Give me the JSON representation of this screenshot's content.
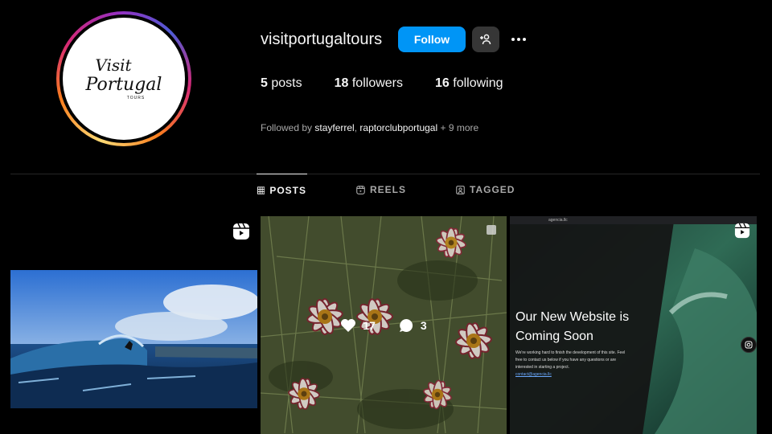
{
  "profile": {
    "username": "visitportugaltours",
    "avatar_logo": {
      "line1": "Visit",
      "line2": "Portugal",
      "line3": "TOURS"
    },
    "follow_label": "Follow",
    "stats": {
      "posts_count": "5",
      "posts_label": "posts",
      "followers_count": "18",
      "followers_label": "followers",
      "following_count": "16",
      "following_label": "following"
    },
    "followed_by": {
      "prefix": "Followed by",
      "user1": "stayferrel",
      "separator": ",",
      "user2": "raptorclubportugal",
      "more": "+ 9 more"
    }
  },
  "tabs": [
    {
      "label": "POSTS",
      "icon": "grid-icon",
      "active": true
    },
    {
      "label": "REELS",
      "icon": "reels-icon",
      "active": false
    },
    {
      "label": "TAGGED",
      "icon": "tagged-icon",
      "active": false
    }
  ],
  "posts": [
    {
      "type": "reel",
      "icon": "reel-icon",
      "subject": "surfer-on-wave"
    },
    {
      "type": "carousel",
      "icon": "carousel-icon",
      "subject": "flowers",
      "likes": "17",
      "comments": "3"
    },
    {
      "type": "reel",
      "icon": "reel-icon",
      "subject": "website-announcement",
      "url": "agencia.llc",
      "title": "Our New Website is Coming Soon",
      "body": "We're working hard to finish the development of this site. Feel free to contact us below if you have any questions or are interested in starting a project.",
      "link": "contact@agencia.llc"
    }
  ],
  "colors": {
    "accent": "#0095f6",
    "background": "#000000",
    "secondary_btn": "#363636"
  }
}
